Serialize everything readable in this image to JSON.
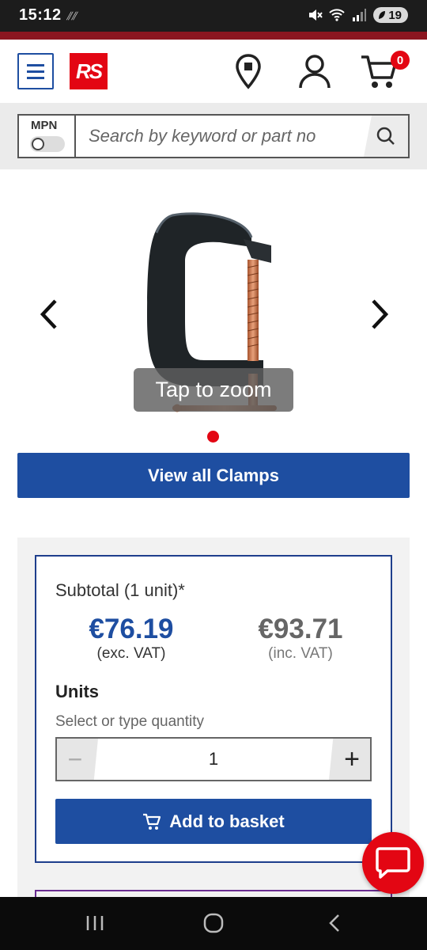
{
  "status_bar": {
    "time": "15:12",
    "battery": "19"
  },
  "header": {
    "logo_text": "RS",
    "basket_count": "0"
  },
  "search": {
    "mpn_label": "MPN",
    "placeholder": "Search by keyword or part no"
  },
  "gallery": {
    "zoom_label": "Tap to zoom"
  },
  "view_all_label": "View all Clamps",
  "price": {
    "subtotal_label": "Subtotal (1 unit)*",
    "exc_vat_price": "€76.19",
    "exc_vat_label": "(exc. VAT)",
    "inc_vat_price": "€93.71",
    "inc_vat_label": "(inc. VAT)",
    "units_label": "Units",
    "units_hint": "Select or type quantity",
    "quantity": "1",
    "minus_label": "−",
    "plus_label": "+",
    "add_to_basket_label": "Add to basket"
  },
  "colors": {
    "brand_blue": "#1e4ea1",
    "brand_red": "#e30613",
    "dark_strip": "#8b1620"
  }
}
